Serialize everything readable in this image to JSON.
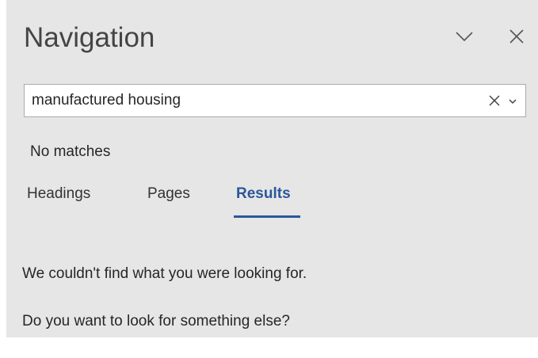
{
  "pane": {
    "title": "Navigation",
    "options_icon": "chevron-down-icon",
    "close_icon": "close-icon"
  },
  "search": {
    "value": "manufactured housing",
    "placeholder": "",
    "clear_icon": "close-icon",
    "dropdown_icon": "chevron-down-icon"
  },
  "status": "No matches",
  "tabs": [
    {
      "label": "Headings",
      "selected": false
    },
    {
      "label": "Pages",
      "selected": false
    },
    {
      "label": "Results",
      "selected": true
    }
  ],
  "results": {
    "message_1": "We couldn't find what you were looking for.",
    "message_2": "Do you want to look for something else?"
  },
  "colors": {
    "pane_background": "#e6e6e6",
    "accent": "#2b579a",
    "text": "#262626"
  }
}
